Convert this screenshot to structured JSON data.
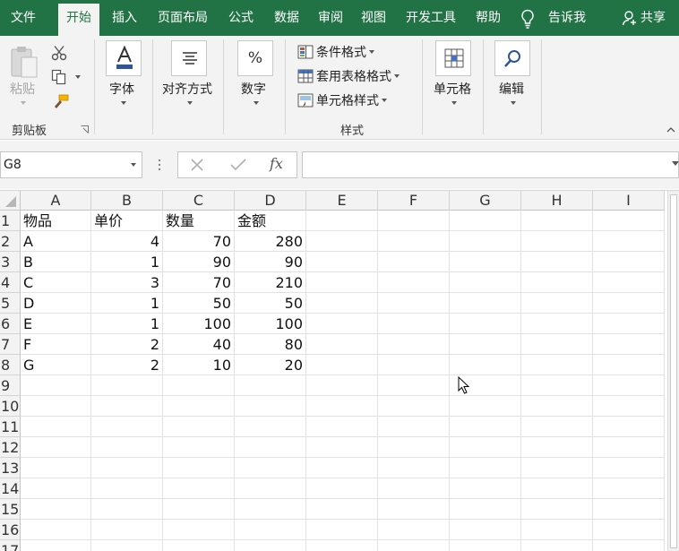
{
  "menu": {
    "tabs": [
      {
        "label": "文件"
      },
      {
        "label": "开始"
      },
      {
        "label": "插入"
      },
      {
        "label": "页面布局"
      },
      {
        "label": "公式"
      },
      {
        "label": "数据"
      },
      {
        "label": "审阅"
      },
      {
        "label": "视图"
      },
      {
        "label": "开发工具"
      },
      {
        "label": "帮助"
      }
    ],
    "active_tab": "开始",
    "tell_me": "告诉我",
    "share": "共享"
  },
  "ribbon": {
    "clipboard": {
      "paste": "粘贴",
      "group_label": "剪贴板"
    },
    "font": {
      "label": "字体"
    },
    "alignment": {
      "label": "对齐方式"
    },
    "number": {
      "label": "数字"
    },
    "styles": {
      "conditional_formatting": "条件格式",
      "format_as_table": "套用表格格式",
      "cell_styles": "单元格样式",
      "group_label": "样式"
    },
    "cells": {
      "label": "单元格"
    },
    "editing": {
      "label": "编辑"
    }
  },
  "formula_bar": {
    "name_box": "G8",
    "fx": "fx",
    "formula": ""
  },
  "sheet": {
    "columns": [
      "A",
      "B",
      "C",
      "D",
      "E",
      "F",
      "G",
      "H",
      "I"
    ],
    "row_numbers": [
      "1",
      "2",
      "3",
      "4",
      "5",
      "6",
      "7",
      "8",
      "9",
      "10",
      "11",
      "12",
      "13",
      "14",
      "15",
      "16",
      "17"
    ],
    "headers": [
      "物品",
      "单价",
      "数量",
      "金额"
    ],
    "rows": [
      [
        "A",
        "4",
        "70",
        "280"
      ],
      [
        "B",
        "1",
        "90",
        "90"
      ],
      [
        "C",
        "3",
        "70",
        "210"
      ],
      [
        "D",
        "1",
        "50",
        "50"
      ],
      [
        "E",
        "1",
        "100",
        "100"
      ],
      [
        "F",
        "2",
        "40",
        "80"
      ],
      [
        "G",
        "2",
        "10",
        "20"
      ]
    ]
  },
  "colors": {
    "accent": "#217346",
    "ribbon_bg": "#f3f3f3",
    "gridline": "#e1e1e1"
  }
}
